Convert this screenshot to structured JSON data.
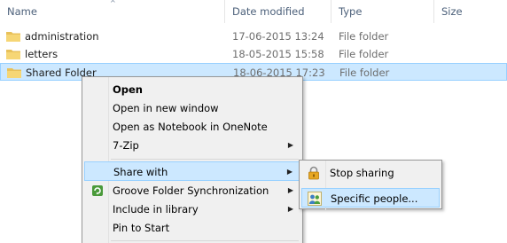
{
  "columns": {
    "name": "Name",
    "date_modified": "Date modified",
    "type": "Type",
    "size": "Size"
  },
  "files": [
    {
      "name": "administration",
      "date": "17-06-2015 13:24",
      "type": "File folder",
      "selected": false
    },
    {
      "name": "letters",
      "date": "18-05-2015 15:58",
      "type": "File folder",
      "selected": false
    },
    {
      "name": "Shared Folder",
      "date": "18-06-2015 17:23",
      "type": "File folder",
      "selected": true
    }
  ],
  "context_menu": {
    "items": [
      {
        "label": "Open",
        "bold": true
      },
      {
        "label": "Open in new window"
      },
      {
        "label": "Open as Notebook in OneNote"
      },
      {
        "label": "7-Zip",
        "submenu": true
      },
      {
        "label": "Share with",
        "submenu": true,
        "highlighted": true
      },
      {
        "label": "Groove Folder Synchronization",
        "submenu": true,
        "icon": "groove-sync-icon"
      },
      {
        "label": "Include in library",
        "submenu": true
      },
      {
        "label": "Pin to Start"
      }
    ]
  },
  "share_submenu": {
    "items": [
      {
        "label": "Stop sharing",
        "icon": "lock-icon"
      },
      {
        "label": "Specific people...",
        "icon": "people-icon",
        "highlighted": true
      }
    ]
  },
  "colors": {
    "selection_bg": "#cce8ff",
    "selection_border": "#99d1ff",
    "header_text": "#4c607a",
    "menu_bg": "#f0f0f0",
    "folder_yellow": "#e8c15a"
  }
}
